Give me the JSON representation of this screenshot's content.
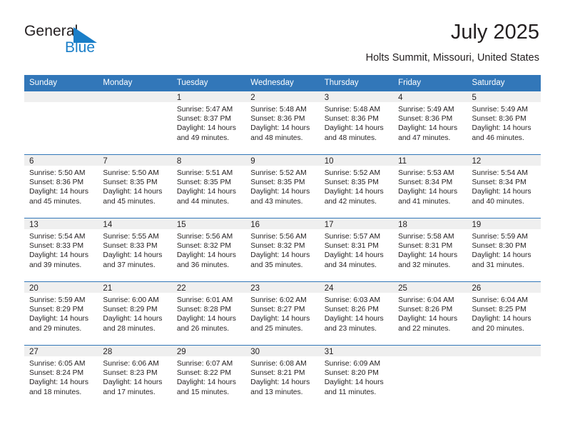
{
  "logo": {
    "text_primary": "General",
    "text_secondary": "Blue",
    "triangle_icon": "triangle-icon",
    "accent_color": "#1a7ec8"
  },
  "header": {
    "month_title": "July 2025",
    "location": "Holts Summit, Missouri, United States"
  },
  "theme": {
    "header_blue": "#3277b9",
    "daynum_band": "#efefef",
    "text": "#231f20"
  },
  "weekday_headers": [
    "Sunday",
    "Monday",
    "Tuesday",
    "Wednesday",
    "Thursday",
    "Friday",
    "Saturday"
  ],
  "weeks": [
    [
      {
        "day": "",
        "sunrise": "",
        "sunset": "",
        "daylight_line1": "",
        "daylight_line2": "",
        "blank": true
      },
      {
        "day": "",
        "sunrise": "",
        "sunset": "",
        "daylight_line1": "",
        "daylight_line2": "",
        "blank": true
      },
      {
        "day": "1",
        "sunrise": "Sunrise: 5:47 AM",
        "sunset": "Sunset: 8:37 PM",
        "daylight_line1": "Daylight: 14 hours",
        "daylight_line2": "and 49 minutes."
      },
      {
        "day": "2",
        "sunrise": "Sunrise: 5:48 AM",
        "sunset": "Sunset: 8:36 PM",
        "daylight_line1": "Daylight: 14 hours",
        "daylight_line2": "and 48 minutes."
      },
      {
        "day": "3",
        "sunrise": "Sunrise: 5:48 AM",
        "sunset": "Sunset: 8:36 PM",
        "daylight_line1": "Daylight: 14 hours",
        "daylight_line2": "and 48 minutes."
      },
      {
        "day": "4",
        "sunrise": "Sunrise: 5:49 AM",
        "sunset": "Sunset: 8:36 PM",
        "daylight_line1": "Daylight: 14 hours",
        "daylight_line2": "and 47 minutes."
      },
      {
        "day": "5",
        "sunrise": "Sunrise: 5:49 AM",
        "sunset": "Sunset: 8:36 PM",
        "daylight_line1": "Daylight: 14 hours",
        "daylight_line2": "and 46 minutes."
      }
    ],
    [
      {
        "day": "6",
        "sunrise": "Sunrise: 5:50 AM",
        "sunset": "Sunset: 8:36 PM",
        "daylight_line1": "Daylight: 14 hours",
        "daylight_line2": "and 45 minutes."
      },
      {
        "day": "7",
        "sunrise": "Sunrise: 5:50 AM",
        "sunset": "Sunset: 8:35 PM",
        "daylight_line1": "Daylight: 14 hours",
        "daylight_line2": "and 45 minutes."
      },
      {
        "day": "8",
        "sunrise": "Sunrise: 5:51 AM",
        "sunset": "Sunset: 8:35 PM",
        "daylight_line1": "Daylight: 14 hours",
        "daylight_line2": "and 44 minutes."
      },
      {
        "day": "9",
        "sunrise": "Sunrise: 5:52 AM",
        "sunset": "Sunset: 8:35 PM",
        "daylight_line1": "Daylight: 14 hours",
        "daylight_line2": "and 43 minutes."
      },
      {
        "day": "10",
        "sunrise": "Sunrise: 5:52 AM",
        "sunset": "Sunset: 8:35 PM",
        "daylight_line1": "Daylight: 14 hours",
        "daylight_line2": "and 42 minutes."
      },
      {
        "day": "11",
        "sunrise": "Sunrise: 5:53 AM",
        "sunset": "Sunset: 8:34 PM",
        "daylight_line1": "Daylight: 14 hours",
        "daylight_line2": "and 41 minutes."
      },
      {
        "day": "12",
        "sunrise": "Sunrise: 5:54 AM",
        "sunset": "Sunset: 8:34 PM",
        "daylight_line1": "Daylight: 14 hours",
        "daylight_line2": "and 40 minutes."
      }
    ],
    [
      {
        "day": "13",
        "sunrise": "Sunrise: 5:54 AM",
        "sunset": "Sunset: 8:33 PM",
        "daylight_line1": "Daylight: 14 hours",
        "daylight_line2": "and 39 minutes."
      },
      {
        "day": "14",
        "sunrise": "Sunrise: 5:55 AM",
        "sunset": "Sunset: 8:33 PM",
        "daylight_line1": "Daylight: 14 hours",
        "daylight_line2": "and 37 minutes."
      },
      {
        "day": "15",
        "sunrise": "Sunrise: 5:56 AM",
        "sunset": "Sunset: 8:32 PM",
        "daylight_line1": "Daylight: 14 hours",
        "daylight_line2": "and 36 minutes."
      },
      {
        "day": "16",
        "sunrise": "Sunrise: 5:56 AM",
        "sunset": "Sunset: 8:32 PM",
        "daylight_line1": "Daylight: 14 hours",
        "daylight_line2": "and 35 minutes."
      },
      {
        "day": "17",
        "sunrise": "Sunrise: 5:57 AM",
        "sunset": "Sunset: 8:31 PM",
        "daylight_line1": "Daylight: 14 hours",
        "daylight_line2": "and 34 minutes."
      },
      {
        "day": "18",
        "sunrise": "Sunrise: 5:58 AM",
        "sunset": "Sunset: 8:31 PM",
        "daylight_line1": "Daylight: 14 hours",
        "daylight_line2": "and 32 minutes."
      },
      {
        "day": "19",
        "sunrise": "Sunrise: 5:59 AM",
        "sunset": "Sunset: 8:30 PM",
        "daylight_line1": "Daylight: 14 hours",
        "daylight_line2": "and 31 minutes."
      }
    ],
    [
      {
        "day": "20",
        "sunrise": "Sunrise: 5:59 AM",
        "sunset": "Sunset: 8:29 PM",
        "daylight_line1": "Daylight: 14 hours",
        "daylight_line2": "and 29 minutes."
      },
      {
        "day": "21",
        "sunrise": "Sunrise: 6:00 AM",
        "sunset": "Sunset: 8:29 PM",
        "daylight_line1": "Daylight: 14 hours",
        "daylight_line2": "and 28 minutes."
      },
      {
        "day": "22",
        "sunrise": "Sunrise: 6:01 AM",
        "sunset": "Sunset: 8:28 PM",
        "daylight_line1": "Daylight: 14 hours",
        "daylight_line2": "and 26 minutes."
      },
      {
        "day": "23",
        "sunrise": "Sunrise: 6:02 AM",
        "sunset": "Sunset: 8:27 PM",
        "daylight_line1": "Daylight: 14 hours",
        "daylight_line2": "and 25 minutes."
      },
      {
        "day": "24",
        "sunrise": "Sunrise: 6:03 AM",
        "sunset": "Sunset: 8:26 PM",
        "daylight_line1": "Daylight: 14 hours",
        "daylight_line2": "and 23 minutes."
      },
      {
        "day": "25",
        "sunrise": "Sunrise: 6:04 AM",
        "sunset": "Sunset: 8:26 PM",
        "daylight_line1": "Daylight: 14 hours",
        "daylight_line2": "and 22 minutes."
      },
      {
        "day": "26",
        "sunrise": "Sunrise: 6:04 AM",
        "sunset": "Sunset: 8:25 PM",
        "daylight_line1": "Daylight: 14 hours",
        "daylight_line2": "and 20 minutes."
      }
    ],
    [
      {
        "day": "27",
        "sunrise": "Sunrise: 6:05 AM",
        "sunset": "Sunset: 8:24 PM",
        "daylight_line1": "Daylight: 14 hours",
        "daylight_line2": "and 18 minutes."
      },
      {
        "day": "28",
        "sunrise": "Sunrise: 6:06 AM",
        "sunset": "Sunset: 8:23 PM",
        "daylight_line1": "Daylight: 14 hours",
        "daylight_line2": "and 17 minutes."
      },
      {
        "day": "29",
        "sunrise": "Sunrise: 6:07 AM",
        "sunset": "Sunset: 8:22 PM",
        "daylight_line1": "Daylight: 14 hours",
        "daylight_line2": "and 15 minutes."
      },
      {
        "day": "30",
        "sunrise": "Sunrise: 6:08 AM",
        "sunset": "Sunset: 8:21 PM",
        "daylight_line1": "Daylight: 14 hours",
        "daylight_line2": "and 13 minutes."
      },
      {
        "day": "31",
        "sunrise": "Sunrise: 6:09 AM",
        "sunset": "Sunset: 8:20 PM",
        "daylight_line1": "Daylight: 14 hours",
        "daylight_line2": "and 11 minutes."
      },
      {
        "day": "",
        "sunrise": "",
        "sunset": "",
        "daylight_line1": "",
        "daylight_line2": "",
        "blank": true
      },
      {
        "day": "",
        "sunrise": "",
        "sunset": "",
        "daylight_line1": "",
        "daylight_line2": "",
        "blank": true
      }
    ]
  ]
}
